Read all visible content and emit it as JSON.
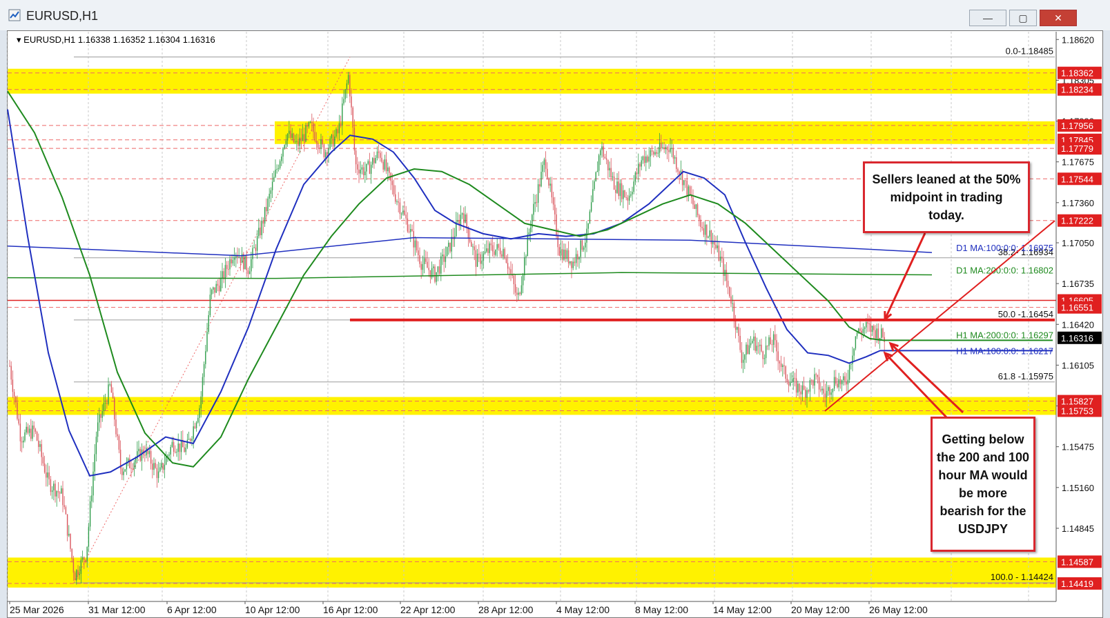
{
  "window": {
    "title": "EURUSD,H1",
    "minimize": "—",
    "maximize": "▢",
    "close": "✕"
  },
  "header": {
    "symbol_menu": "▾",
    "symbol": "EURUSD,H1",
    "ohlc": "1.16338 1.16352 1.16304 1.16316"
  },
  "colors": {
    "bull": "#2e9c4a",
    "bear": "#d9545c",
    "h1ma100": "#1f2fbf",
    "h1ma200": "#1e8a1e",
    "d1ma100": "#1f2fbf",
    "d1ma200": "#1e8a1e",
    "zone": "#fff200",
    "red": "#e02020",
    "current_tag": "#000000"
  },
  "price_axis": {
    "min": 1.1428,
    "max": 1.1868,
    "ticks": [
      "1.18620",
      "1.18305",
      "1.17990",
      "1.17675",
      "1.17360",
      "1.17050",
      "1.16735",
      "1.16420",
      "1.16105",
      "1.15790",
      "1.15475",
      "1.15160",
      "1.14845"
    ],
    "tick_values": [
      1.1862,
      1.18305,
      1.1799,
      1.17675,
      1.1736,
      1.1705,
      1.16735,
      1.1642,
      1.16105,
      1.1579,
      1.15475,
      1.1516,
      1.14845
    ],
    "red_tags": [
      {
        "label": "1.18362",
        "value": 1.18362
      },
      {
        "label": "1.18234",
        "value": 1.18234
      },
      {
        "label": "1.17956",
        "value": 1.17956
      },
      {
        "label": "1.17845",
        "value": 1.17845
      },
      {
        "label": "1.17779",
        "value": 1.17779
      },
      {
        "label": "1.17544",
        "value": 1.17544
      },
      {
        "label": "1.17222",
        "value": 1.17222
      },
      {
        "label": "1.16605",
        "value": 1.16605
      },
      {
        "label": "1.16551",
        "value": 1.16551
      },
      {
        "label": "1.15827",
        "value": 1.15827
      },
      {
        "label": "1.15753",
        "value": 1.15753
      },
      {
        "label": "1.14587",
        "value": 1.14587
      },
      {
        "label": "1.14419",
        "value": 1.14419
      }
    ],
    "current": {
      "label": "1.16316",
      "value": 1.16316
    }
  },
  "time_axis": [
    "25 Mar 2026",
    "31 Mar 12:00",
    "6 Apr 12:00",
    "10 Apr 12:00",
    "16 Apr 12:00",
    "22 Apr 12:00",
    "28 Apr 12:00",
    "4 May 12:00",
    "8 May 12:00",
    "14 May 12:00",
    "20 May 12:00",
    "26 May 12:00"
  ],
  "fib_levels": [
    {
      "label": "0.0-1.18485",
      "value": 1.18485
    },
    {
      "label": "38.2- 1.16934",
      "value": 1.16934
    },
    {
      "label": "50.0 -1.16454",
      "value": 1.16454
    },
    {
      "label": "61.8 -1.15975",
      "value": 1.15975
    },
    {
      "label": "100.0 - 1.14424",
      "value": 1.14424
    }
  ],
  "ma_labels": [
    {
      "label": "D1 MA:100:0:0: 1.16975",
      "value": 1.16975,
      "color": "#1f2fbf"
    },
    {
      "label": "D1 MA:200:0:0: 1.16802",
      "value": 1.16802,
      "color": "#1e8a1e"
    },
    {
      "label": "H1 MA:200:0:0: 1.16297",
      "value": 1.16297,
      "color": "#1e8a1e"
    },
    {
      "label": "H1 MA:100:0:0: 1.16217",
      "value": 1.16217,
      "color": "#1f2fbf"
    }
  ],
  "zones": [
    {
      "from": 1.18234,
      "to": 1.18362
    },
    {
      "from": 1.17845,
      "to": 1.17956
    },
    {
      "from": 1.15753,
      "to": 1.15827
    },
    {
      "from": 1.14419,
      "to": 1.14587
    }
  ],
  "annotations": {
    "sellers": "Sellers leaned at the 50% midpoint in trading today.",
    "getting_below": "Getting below the 200 and 100 hour MA would be more bearish for the USDJPY"
  }
}
